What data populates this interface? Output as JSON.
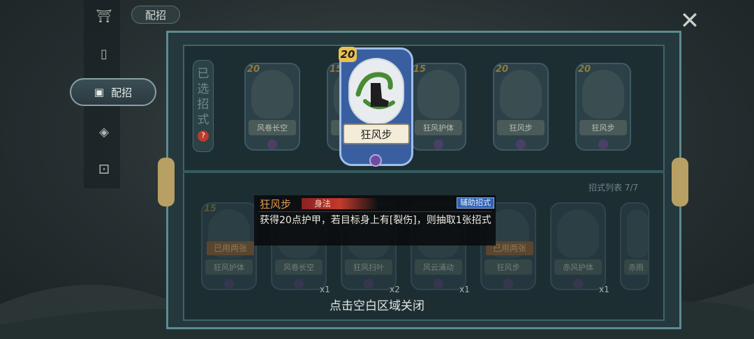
{
  "header": {
    "tab_label": "配招",
    "close_glyph": "✕"
  },
  "sidebar": {
    "items": [
      {
        "icon": "pagoda-icon",
        "glyph": "⛩"
      },
      {
        "icon": "cards-icon",
        "glyph": "▯"
      },
      {
        "icon": "deck-icon",
        "label": "配招",
        "glyph": "▣",
        "active": true
      },
      {
        "icon": "emblem-icon",
        "glyph": "◈"
      },
      {
        "icon": "dice-icon",
        "glyph": "⚀"
      }
    ]
  },
  "selected": {
    "label_chars": [
      "已",
      "选",
      "招",
      "式"
    ],
    "help_glyph": "?",
    "cards": [
      {
        "name": "风卷长空",
        "cost": "20"
      },
      {
        "name": "",
        "cost": "15"
      },
      {
        "name": "狂风护体",
        "cost": "15"
      },
      {
        "name": "狂风步",
        "cost": "20"
      },
      {
        "name": "狂风步",
        "cost": "20"
      }
    ]
  },
  "featured_card": {
    "name": "狂风步",
    "cost": "20"
  },
  "tooltip": {
    "name": "狂风步",
    "type": "身法",
    "tag": "辅助招式",
    "description": "获得20点护甲，若目标身上有[裂伤]，则抽取1张招式"
  },
  "library": {
    "list_label": "招式列表",
    "count": "7/7",
    "cards": [
      {
        "name": "狂风护体",
        "cost": "15",
        "used": "已用两张",
        "count": ""
      },
      {
        "name": "风卷长空",
        "cost": "",
        "used": "",
        "count": "x1"
      },
      {
        "name": "狂风扫叶",
        "cost": "",
        "used": "",
        "count": "x2"
      },
      {
        "name": "风云涌动",
        "cost": "",
        "used": "",
        "count": "x1"
      },
      {
        "name": "狂风步",
        "cost": "",
        "used": "已用两张",
        "count": ""
      },
      {
        "name": "赤风护体",
        "cost": "",
        "used": "",
        "count": "x1"
      },
      {
        "name": "赤雨",
        "cost": "",
        "used": "",
        "count": ""
      }
    ]
  },
  "close_hint": "点击空白区域关闭",
  "colors": {
    "accent_blue": "#3a5fa0",
    "tooltip_tag": "#2e62b8",
    "cost_gold": "#e9c052"
  }
}
